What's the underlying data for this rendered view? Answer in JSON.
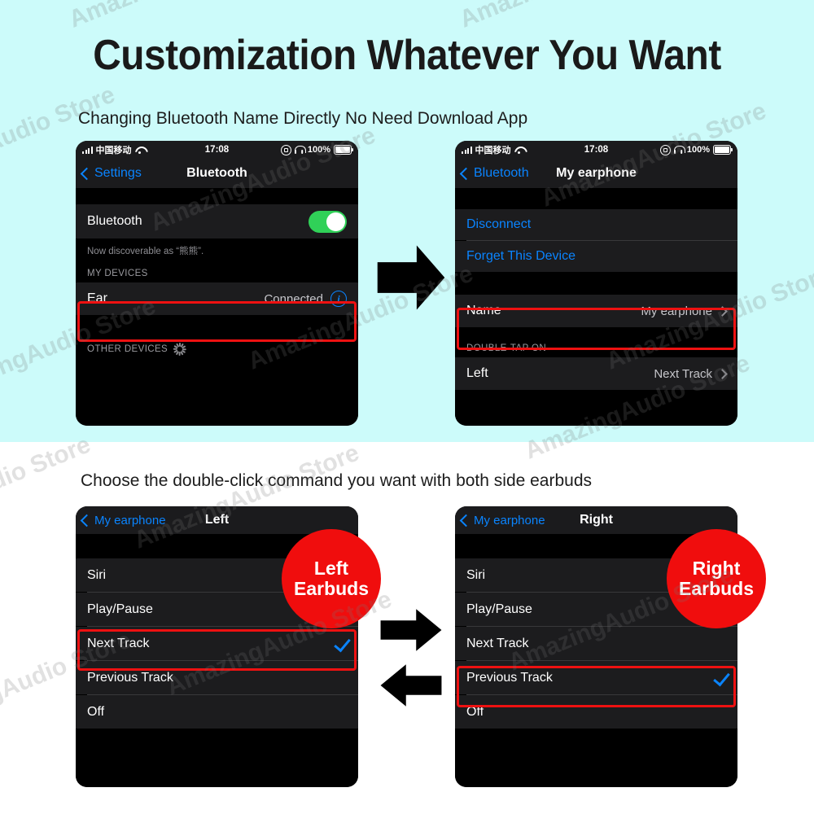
{
  "page": {
    "title": "Customization Whatever You Want",
    "subtitle_1": "Changing Bluetooth Name Directly No Need Download App",
    "subtitle_2": "Choose the double-click command you want with both side earbuds",
    "colors": {
      "band_top_bg": "#ccfbfa",
      "band_bottom_bg": "#ffffff",
      "highlight_red": "#ee1111",
      "badge_red": "#f00d0d",
      "ios_blue": "#0a84ff",
      "toggle_green": "#30d158"
    },
    "watermark_text": "AmazingAudio Store"
  },
  "status_bar": {
    "carrier": "中国移动",
    "time": "17:08",
    "battery_percent": "100%",
    "icons": [
      "signal-bars-icon",
      "wifi-icon",
      "rotation-lock-icon",
      "headphones-icon",
      "battery-icon"
    ]
  },
  "phone_1": {
    "name": "bluetooth-settings-screen",
    "nav": {
      "back_label": "Settings",
      "title": "Bluetooth"
    },
    "bluetooth_row": {
      "label": "Bluetooth",
      "toggle_on": true
    },
    "discoverable_caption": "Now discoverable as “熊熊”.",
    "my_devices_header": "MY DEVICES",
    "device_row": {
      "label": "Ear",
      "status": "Connected",
      "info_icon": "info-icon",
      "highlighted": true
    },
    "other_devices_header": "OTHER DEVICES",
    "other_devices_spinner": "loading-spinner-icon"
  },
  "phone_2": {
    "name": "my-earphone-detail-screen",
    "nav": {
      "back_label": "Bluetooth",
      "title": "My earphone"
    },
    "actions": [
      "Disconnect",
      "Forget This Device"
    ],
    "name_row": {
      "label": "Name",
      "value": "My earphone",
      "highlighted": true
    },
    "double_tap_header": "DOUBLE-TAP ON",
    "left_row": {
      "label": "Left",
      "value": "Next Track"
    }
  },
  "phone_3": {
    "name": "left-earbud-action-screen",
    "nav": {
      "back_label": "My earphone",
      "title": "Left"
    },
    "options": [
      {
        "label": "Siri",
        "selected": false
      },
      {
        "label": "Play/Pause",
        "selected": false
      },
      {
        "label": "Next Track",
        "selected": true
      },
      {
        "label": "Previous Track",
        "selected": false
      },
      {
        "label": "Off",
        "selected": false
      }
    ],
    "badge": {
      "line1": "Left",
      "line2": "Earbuds"
    }
  },
  "phone_4": {
    "name": "right-earbud-action-screen",
    "nav": {
      "back_label": "My earphone",
      "title": "Right"
    },
    "options": [
      {
        "label": "Siri",
        "selected": false
      },
      {
        "label": "Play/Pause",
        "selected": false
      },
      {
        "label": "Next Track",
        "selected": false
      },
      {
        "label": "Previous Track",
        "selected": true
      },
      {
        "label": "Off",
        "selected": false
      }
    ],
    "badge": {
      "line1": "Right",
      "line2": "Earbuds"
    }
  },
  "arrows": {
    "top": "arrow-right-icon",
    "bottom_upper": "arrow-right-icon",
    "bottom_lower": "arrow-left-icon"
  }
}
